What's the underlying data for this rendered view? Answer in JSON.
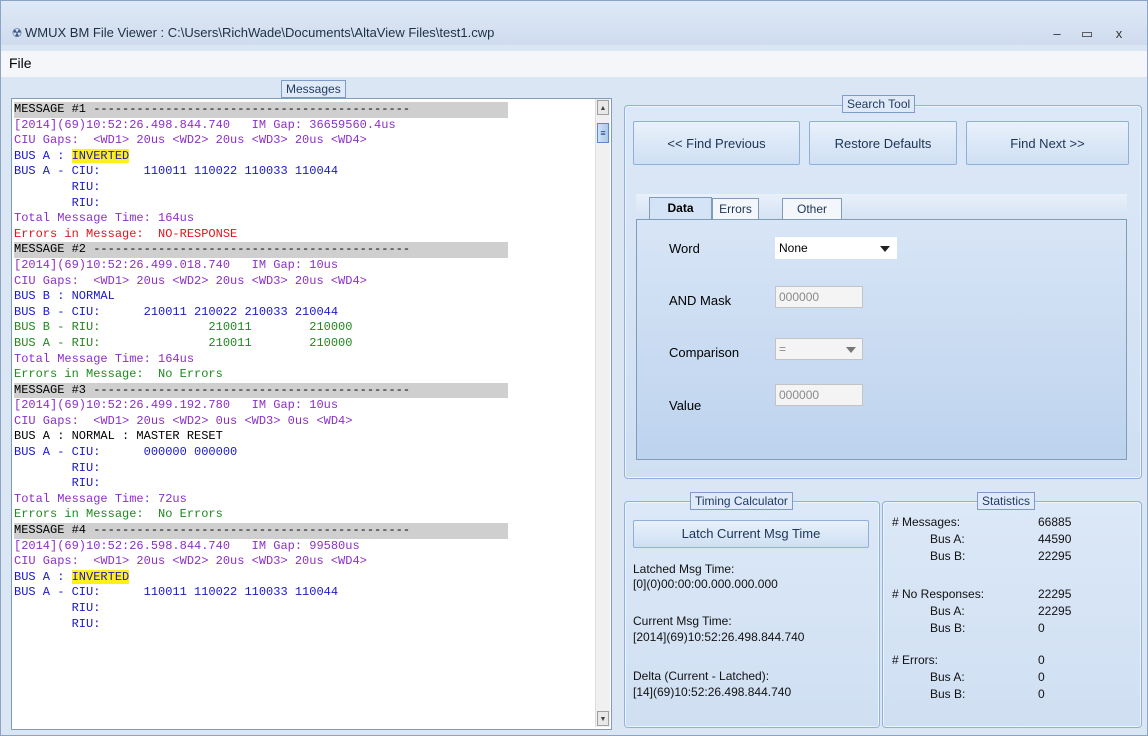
{
  "window": {
    "title": "WMUX BM File Viewer : C:\\Users\\RichWade\\Documents\\AltaView Files\\test1.cwp",
    "minimize": "–",
    "maximize": "▭",
    "close": "x"
  },
  "menu": {
    "file": "File"
  },
  "messages": {
    "label": "Messages",
    "lines": [
      "MESSAGE #1 --------------------------------------------",
      "[2014](69)10:52:26.498.844.740   IM Gap: 36659560.4us",
      "CIU Gaps:  <WD1> 20us <WD2> 20us <WD3> 20us <WD4>",
      "BUS A : ",
      "INVERTED",
      "BUS A - CIU:      110011 110022 110033 110044",
      "        RIU:",
      "        RIU:",
      "Total Message Time: 164us",
      "Errors in Message:  NO-RESPONSE",
      "MESSAGE #2 --------------------------------------------",
      "[2014](69)10:52:26.499.018.740   IM Gap: 10us",
      "CIU Gaps:  <WD1> 20us <WD2> 20us <WD3> 20us <WD4>",
      "BUS B : NORMAL",
      "BUS B - CIU:      210011 210022 210033 210044",
      "BUS B - RIU:               210011        210000",
      "BUS A - RIU:               210011        210000",
      "Total Message Time: 164us",
      "Errors in Message:  No Errors",
      "MESSAGE #3 --------------------------------------------",
      "[2014](69)10:52:26.499.192.780   IM Gap: 10us",
      "CIU Gaps:  <WD1> 20us <WD2> 0us <WD3> 0us <WD4>",
      "BUS A : NORMAL : MASTER RESET",
      "BUS A - CIU:      000000 000000",
      "        RIU:",
      "        RIU:",
      "Total Message Time: 72us",
      "Errors in Message:  No Errors",
      "MESSAGE #4 --------------------------------------------",
      "[2014](69)10:52:26.598.844.740   IM Gap: 99580us",
      "CIU Gaps:  <WD1> 20us <WD2> 20us <WD3> 20us <WD4>",
      "BUS A : ",
      "INVERTED",
      "BUS A - CIU:      110011 110022 110033 110044",
      "        RIU:",
      "        RIU:"
    ]
  },
  "search": {
    "label": "Search Tool",
    "find_previous": "<< Find Previous",
    "restore_defaults": "Restore Defaults",
    "find_next": "Find Next >>",
    "tabs": [
      "Data",
      "Errors",
      "Other"
    ],
    "word_label": "Word",
    "word_value": "None",
    "and_mask_label": "AND Mask",
    "and_mask_value": "000000",
    "comparison_label": "Comparison",
    "comparison_value": "=",
    "value_label": "Value",
    "value_value": "000000"
  },
  "timing": {
    "label": "Timing Calculator",
    "latch_button": "Latch Current Msg Time",
    "latched_label": "Latched Msg Time:",
    "latched_value": "[0](0)00:00:00.000.000.000",
    "current_label": "Current Msg Time:",
    "current_value": "[2014](69)10:52:26.498.844.740",
    "delta_label": "Delta (Current - Latched):",
    "delta_value": "[14](69)10:52:26.498.844.740"
  },
  "statistics": {
    "label": "Statistics",
    "messages_label": "# Messages:",
    "messages_value": "66885",
    "messages_bus_a_label": "Bus A:",
    "messages_bus_a_value": "44590",
    "messages_bus_b_label": "Bus B:",
    "messages_bus_b_value": "22295",
    "noresp_label": "# No Responses:",
    "noresp_value": "22295",
    "noresp_bus_a_label": "Bus A:",
    "noresp_bus_a_value": "22295",
    "noresp_bus_b_label": "Bus B:",
    "noresp_bus_b_value": "0",
    "errors_label": "# Errors:",
    "errors_value": "0",
    "errors_bus_a_label": "Bus A:",
    "errors_bus_a_value": "0",
    "errors_bus_b_label": "Bus B:",
    "errors_bus_b_value": "0"
  },
  "colors": {
    "header_bg": "#cfcfcf",
    "timestamp": "#8c2fc9",
    "bus": "#1919c8",
    "error": "#e3131b",
    "ok": "#1e8a1e",
    "highlight": "#ffef1a"
  }
}
